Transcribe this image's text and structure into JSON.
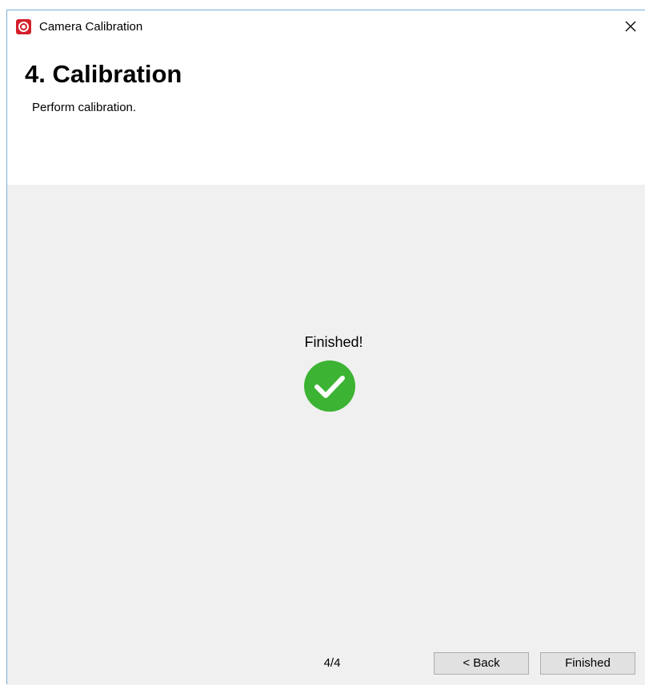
{
  "window": {
    "title": "Camera Calibration",
    "icon": "camera-target-icon",
    "accent_color": "#d51f2b"
  },
  "header": {
    "title": "4. Calibration",
    "subtitle": "Perform calibration."
  },
  "content": {
    "status_text": "Finished!",
    "status_icon": "checkmark-circle-icon",
    "status_color": "#3cb332"
  },
  "footer": {
    "step": "4/4",
    "back_label": "< Back",
    "finish_label": "Finished"
  }
}
